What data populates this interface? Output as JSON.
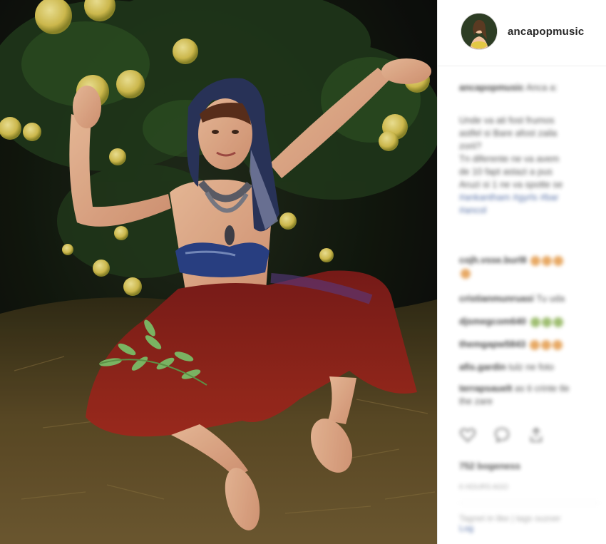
{
  "post": {
    "username": "ancapopmusic"
  },
  "caption": {
    "username": "ancapopmusic",
    "text": "Anca a:",
    "lines": [
      "Unde va ati fost frumos",
      "astfel si Bare afost zaila",
      "zorii?",
      "Tn diferente ne va avem",
      "de 10 fapt astazi a pus",
      "Aruzi si 1 ne va spotte se"
    ],
    "hashtags": "#ankantham #gyrls #bar",
    "hashtags2": "#ancol"
  },
  "comments": [
    {
      "user": "cojh.vsse.burl8",
      "text": ""
    },
    {
      "user": "cristianmunruasi",
      "text": "Tu uda"
    },
    {
      "user": "djsmegcom640",
      "text": ""
    },
    {
      "user": "themgapw5843",
      "text": ""
    },
    {
      "user": "afis.gardin",
      "text": "tulz ne foto"
    },
    {
      "user": "terrapsauelt",
      "text": "as ti crinte tle"
    },
    {
      "user": "",
      "text": "the zare"
    }
  ],
  "likes": "752 bogeness",
  "time_ago": "6 HOURS AGO",
  "login_prompt": "Tagnet in like | tags ouzoer",
  "login_link": "Log",
  "colors": {
    "username": "#262626",
    "link": "#3b5998",
    "emoji_orange": "#e39a4a",
    "emoji_green": "#8fb35a"
  }
}
